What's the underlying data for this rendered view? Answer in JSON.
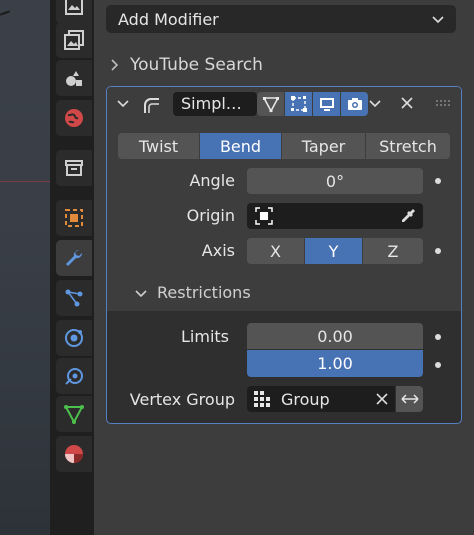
{
  "header": {
    "add_modifier": "Add Modifier",
    "youtube_search": "YouTube Search"
  },
  "modifier": {
    "name": "Simpl…",
    "deform_tabs": [
      "Twist",
      "Bend",
      "Taper",
      "Stretch"
    ],
    "active_tab": "Bend",
    "angle_label": "Angle",
    "angle_value": "0°",
    "origin_label": "Origin",
    "axis_label": "Axis",
    "axes": [
      "X",
      "Y",
      "Z"
    ],
    "active_axis": "Y",
    "restrictions_label": "Restrictions",
    "limits_label": "Limits",
    "limit_min": "0.00",
    "limit_max": "1.00",
    "vertex_group_label": "Vertex Group",
    "vertex_group_value": "Group"
  },
  "tabs": [
    "image-icon",
    "texture-icon",
    "shading-icon",
    "world-icon",
    "collection-icon",
    "object-icon",
    "modifier-wrench-icon",
    "particles-icon",
    "physics-icon",
    "constraints-icon",
    "data-icon",
    "material-icon"
  ],
  "colors": {
    "accent": "#4772b3",
    "panel": "#3d3d3d",
    "field": "#545454",
    "field_dark": "#1d1d1d",
    "outline": "#5680c2"
  }
}
